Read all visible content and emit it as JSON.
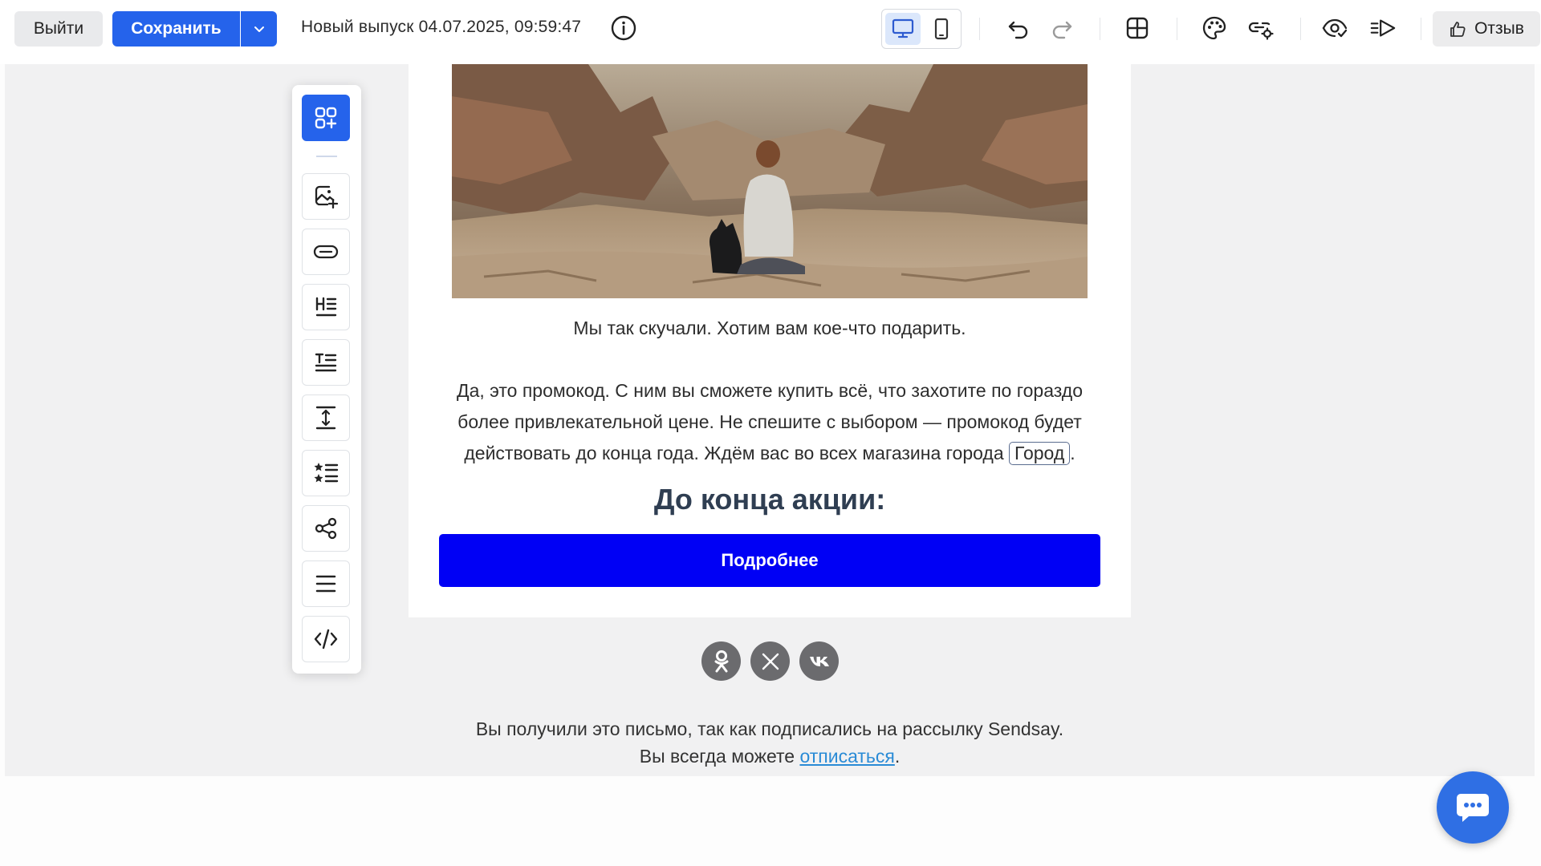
{
  "toolbar": {
    "exit_label": "Выйти",
    "save_label": "Сохранить",
    "issue_title": "Новый выпуск 04.07.2025, 09:59:47",
    "feedback_label": "Отзыв",
    "icons": [
      "info-icon",
      "desktop-icon",
      "mobile-icon",
      "undo-icon",
      "redo-icon",
      "layout-grid-icon",
      "palette-icon",
      "link-settings-icon",
      "preview-icon",
      "send-test-icon",
      "thumbs-up-icon"
    ],
    "accent_color": "#2563eb"
  },
  "blocks_panel": {
    "items": [
      "add-block-icon",
      "image-icon",
      "button-icon",
      "heading-icon",
      "text-icon",
      "spacer-icon",
      "list-icon",
      "share-icon",
      "menu-icon",
      "code-icon"
    ]
  },
  "email": {
    "caption": "Мы так скучали. Хотим вам кое-что подарить.",
    "body_before_tag": "Да, это промокод. С ним вы сможете купить всё, что захотите по гораздо более привлекательной цене. Не спешите с выбором — промокод будет действовать до конца года. Ждём вас во всех магазина города ",
    "city_tag": "Город",
    "body_after_tag": ".",
    "timer_heading": "До конца акции:",
    "cta_label": "Подробнее",
    "cta_color": "#0000f5",
    "socials": [
      "odnoklassniki-icon",
      "x-icon",
      "vk-icon"
    ],
    "footer_line1": "Вы получили это письмо, так как подписались на рассылку Sendsay.",
    "footer_line2_prefix": "Вы всегда можете ",
    "footer_unsubscribe": "отписаться",
    "footer_line2_suffix": "."
  }
}
